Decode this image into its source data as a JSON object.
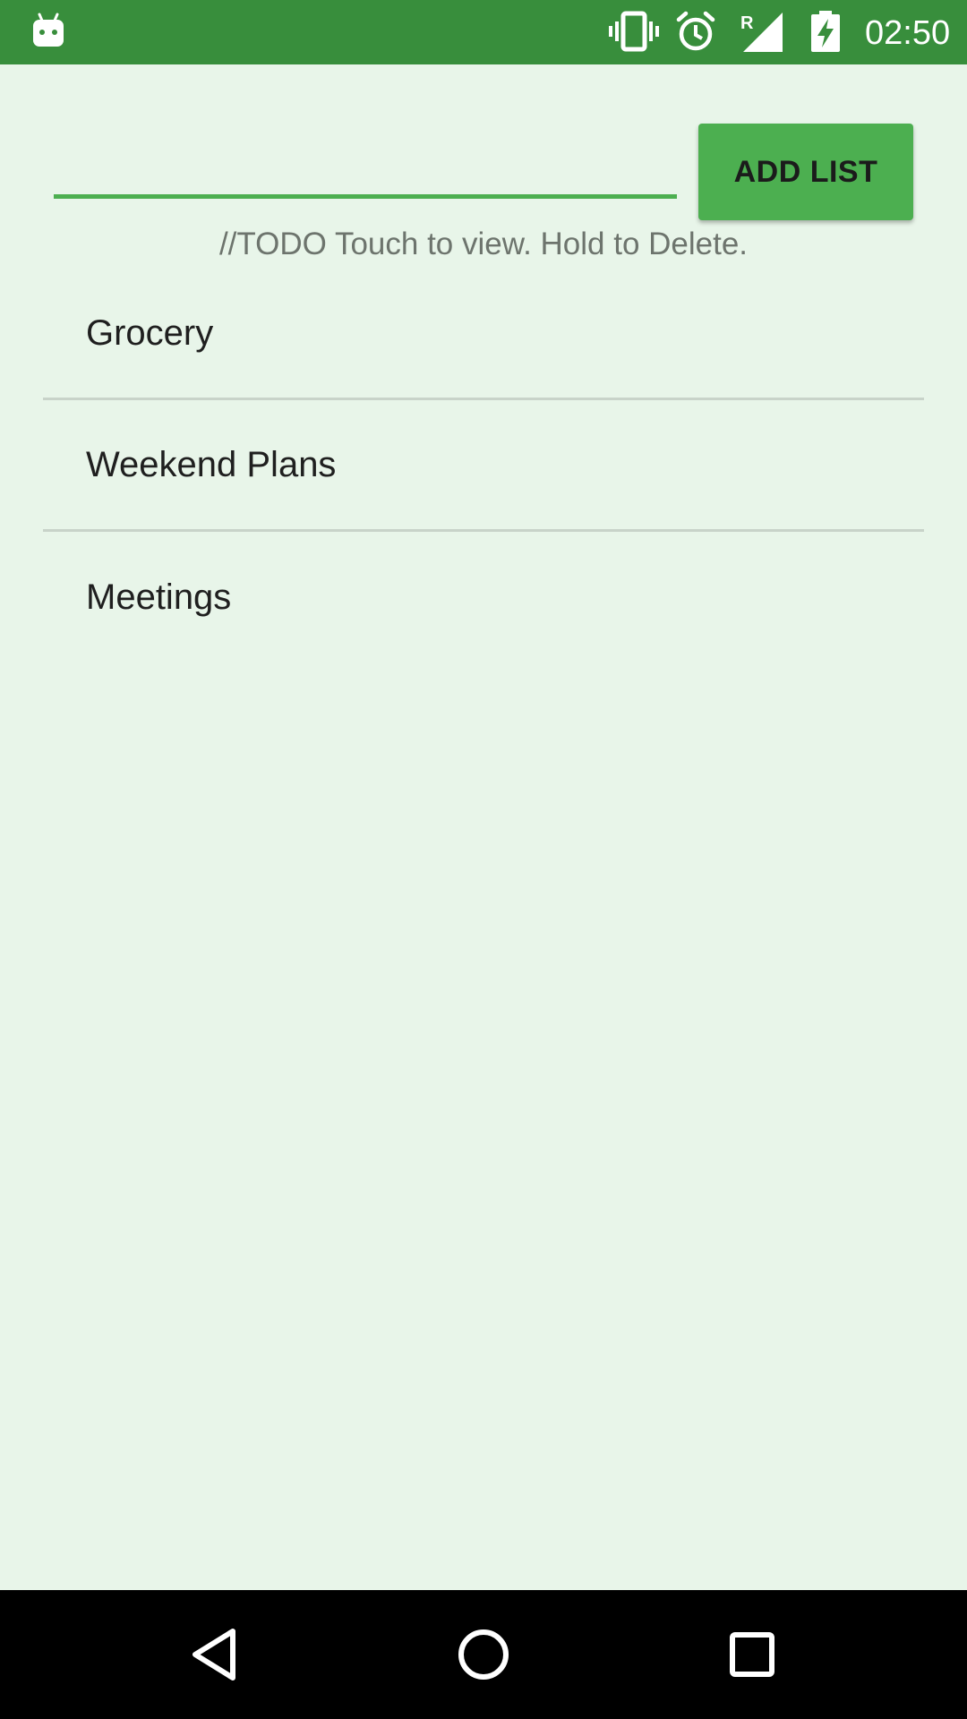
{
  "status_bar": {
    "time": "02:50",
    "signal_label": "R",
    "icons": [
      "android-notification-icon",
      "vibrate-icon",
      "alarm-icon",
      "signal-icon",
      "battery-charging-icon"
    ]
  },
  "input": {
    "value": "",
    "placeholder": ""
  },
  "add_list_button": {
    "label": "ADD LIST"
  },
  "hint": "//TODO Touch to view. Hold to Delete.",
  "lists": [
    {
      "label": "Grocery"
    },
    {
      "label": "Weekend Plans"
    },
    {
      "label": "Meetings"
    }
  ],
  "nav_bar": {
    "icons": [
      "back-icon",
      "home-icon",
      "recents-icon"
    ]
  },
  "colors": {
    "status_bar": "#388E3C",
    "accent": "#4CAF50",
    "background": "#E8F5E9",
    "nav_bar": "#000000"
  }
}
